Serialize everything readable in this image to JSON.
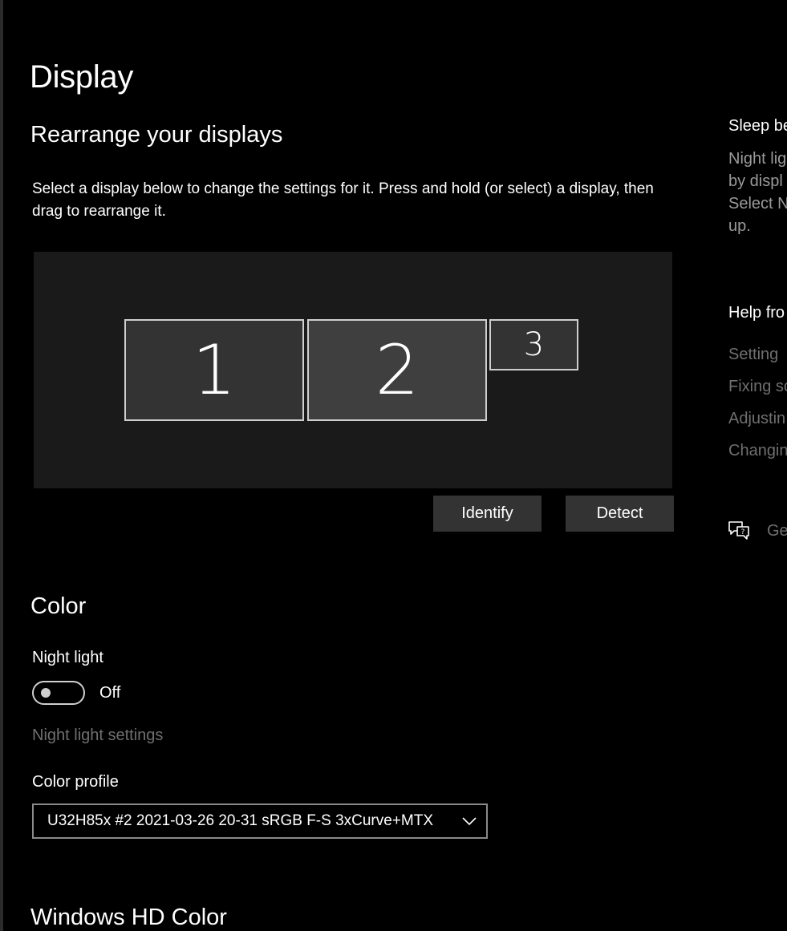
{
  "page": {
    "title": "Display"
  },
  "arrange": {
    "heading": "Rearrange your displays",
    "description": "Select a display below to change the settings for it. Press and hold (or select) a display, then drag to rearrange it.",
    "displays": [
      {
        "label": "1",
        "selected": false
      },
      {
        "label": "2",
        "selected": true
      },
      {
        "label": "3",
        "selected": false
      }
    ],
    "identify_label": "Identify",
    "detect_label": "Detect"
  },
  "color": {
    "heading": "Color",
    "night_light_label": "Night light",
    "night_light_state": "Off",
    "night_light_settings_link": "Night light settings",
    "color_profile_label": "Color profile",
    "color_profile_value": "U32H85x #2 2021-03-26 20-31 sRGB F-S 3xCurve+MTX"
  },
  "hd_color": {
    "heading": "Windows HD Color"
  },
  "side": {
    "sleep_heading": "Sleep be",
    "night_text": [
      "Night lig",
      "by displ",
      "Select N",
      "up."
    ],
    "help_heading": "Help fro",
    "help_links": [
      "Setting",
      "Fixing sc",
      "Adjustin",
      "Changin"
    ],
    "feedback_label": "Ge"
  },
  "colors": {
    "background": "#000000",
    "tile": "#333333",
    "button": "#333333",
    "disabled_text": "#6f6f6f"
  }
}
